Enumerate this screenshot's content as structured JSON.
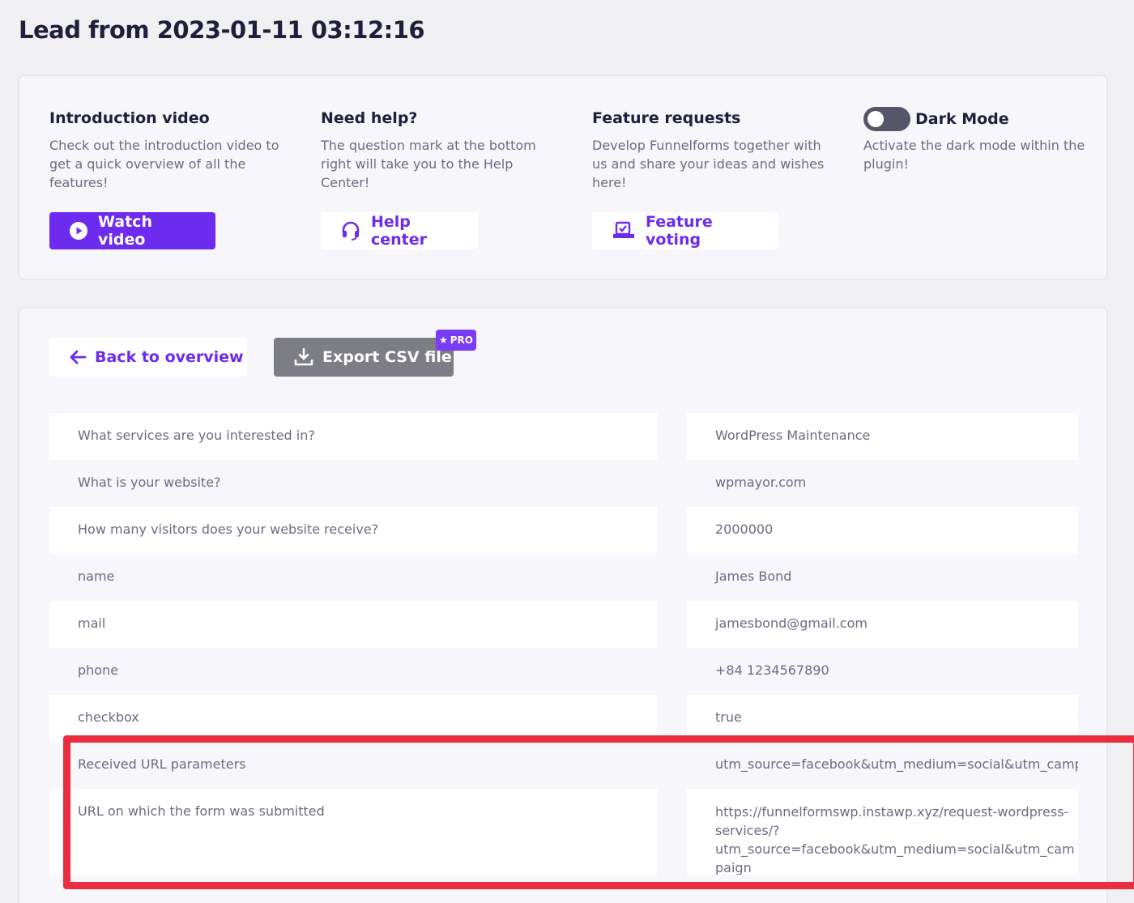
{
  "page_title": "Lead from 2023-01-11 03:12:16",
  "intro": {
    "title": "Introduction video",
    "text": "Check out the introduction video to get a quick overview of all the features!",
    "button": "Watch video"
  },
  "help": {
    "title": "Need help?",
    "text": "The question mark at the bottom right will take you to the Help Center!",
    "button": "Help center"
  },
  "feature": {
    "title": "Feature requests",
    "text": "Develop Funnelforms together with us and share your ideas and wishes here!",
    "button": "Feature voting"
  },
  "dark_mode": {
    "title": "Dark Mode",
    "text": "Activate the dark mode within the plugin!",
    "enabled": false
  },
  "toolbar": {
    "back_label": "Back to overview",
    "export_label": "Export CSV file",
    "pro_badge": "PRO"
  },
  "lead_rows": [
    {
      "question": "What services are you interested in?",
      "answer": "WordPress Maintenance"
    },
    {
      "question": "What is your website?",
      "answer": "wpmayor.com"
    },
    {
      "question": "How many visitors does your website receive?",
      "answer": "2000000"
    },
    {
      "question": "name",
      "answer": "James Bond"
    },
    {
      "question": "mail",
      "answer": "jamesbond@gmail.com"
    },
    {
      "question": "phone",
      "answer": "+84 1234567890"
    },
    {
      "question": "checkbox",
      "answer": "true"
    },
    {
      "question": "Received URL parameters",
      "answer": "utm_source=facebook&utm_medium=social&utm_campaign"
    },
    {
      "question": "URL on which the form was submitted",
      "answer": "https://funnelformswp.instawp.xyz/request-wordpress-services/?utm_source=facebook&utm_medium=social&utm_campaign"
    }
  ],
  "colors": {
    "accent": "#6c2bee",
    "highlight": "#ea2e3f",
    "export_disabled": "#7d7d85"
  },
  "icons": [
    "play-icon",
    "headset-icon",
    "vote-icon",
    "arrow-left-icon",
    "download-icon",
    "star-icon"
  ]
}
